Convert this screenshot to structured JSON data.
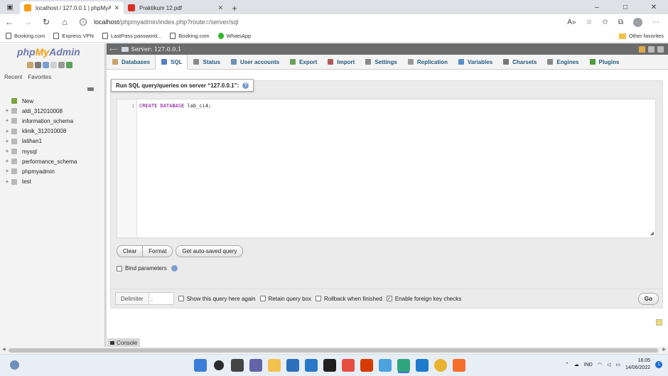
{
  "browser": {
    "tabs": [
      {
        "title": "localhost / 127.0.0.1 | phpMyAdmin",
        "active": true,
        "favicon_color": "#f89c0e"
      },
      {
        "title": "Praktikum 12.pdf",
        "active": false,
        "favicon_color": "#d93025"
      }
    ],
    "new_tab_label": "+",
    "url_host": "localhost",
    "url_path": "/phpmyadmin/index.php?route=/server/sql",
    "window_controls": [
      "–",
      "□",
      "✕"
    ],
    "bookmarks": [
      "Booking.com",
      "Express VPN",
      "LastPass password...",
      "Booking.com",
      "WhatsApp"
    ],
    "other_favorites": "Other favorites"
  },
  "sidebar": {
    "logo_php": "php",
    "logo_my": "My",
    "logo_admin": "Admin",
    "tab_recent": "Recent",
    "tab_favorites": "Favorites",
    "databases": [
      "New",
      "aldi_312010008",
      "information_schema",
      "klinik_312010008",
      "latihan1",
      "mysql",
      "performance_schema",
      "phpmyadmin",
      "test"
    ]
  },
  "main": {
    "server_label": "Server: 127.0.0.1",
    "menu": [
      {
        "label": "Databases",
        "color": "#c9a36b"
      },
      {
        "label": "SQL",
        "color": "#5a7dbd",
        "active": true
      },
      {
        "label": "Status",
        "color": "#888888"
      },
      {
        "label": "User accounts",
        "color": "#6d8fb8"
      },
      {
        "label": "Export",
        "color": "#6aa05a"
      },
      {
        "label": "Import",
        "color": "#b05a5a"
      },
      {
        "label": "Settings",
        "color": "#888888"
      },
      {
        "label": "Replication",
        "color": "#999999"
      },
      {
        "label": "Variables",
        "color": "#5a8fc9"
      },
      {
        "label": "Charsets",
        "color": "#777777"
      },
      {
        "label": "Engines",
        "color": "#888888"
      },
      {
        "label": "Plugins",
        "color": "#4f9a3a"
      }
    ],
    "query_title": "Run SQL query/queries on server “127.0.0.1”:",
    "line_number": "1",
    "code_keyword": "CREATE DATABASE",
    "code_rest": " lab_ci4;",
    "buttons": {
      "clear": "Clear",
      "format": "Format",
      "autosaved": "Get auto-saved query"
    },
    "bind_parameters": "Bind parameters",
    "delimiter_label": "Delimiter",
    "delimiter_value": ";",
    "options": [
      {
        "label": "Show this query here again",
        "checked": false
      },
      {
        "label": "Retain query box",
        "checked": false
      },
      {
        "label": "Rollback when finished",
        "checked": false
      },
      {
        "label": "Enable foreign key checks",
        "checked": true
      }
    ],
    "go": "Go",
    "console": "Console"
  },
  "taskbar": {
    "language": "IND",
    "time": "18.05",
    "date": "14/06/2022",
    "notifications": "1"
  }
}
